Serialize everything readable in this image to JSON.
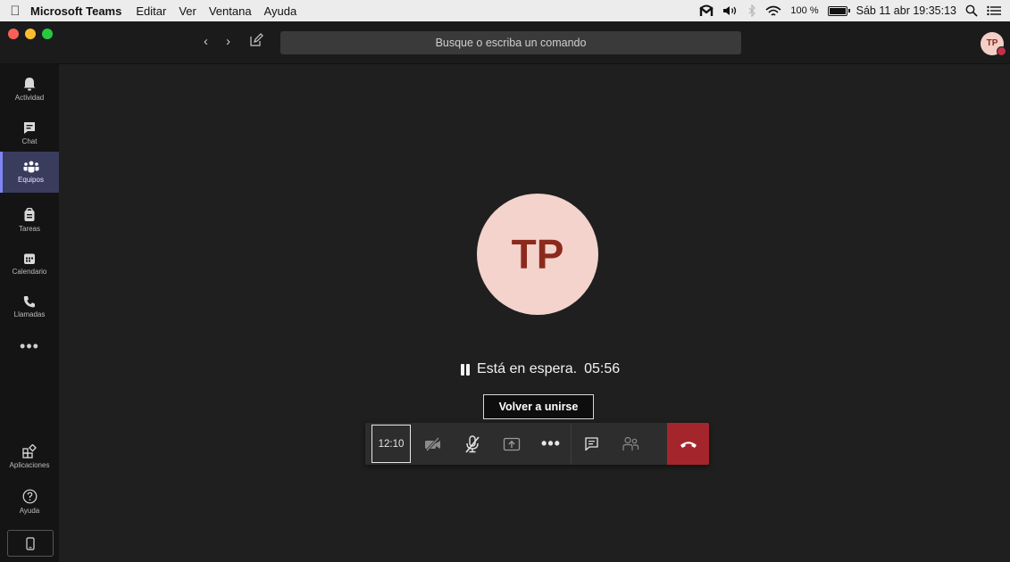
{
  "menubar": {
    "apple_icon": "apple-logo-icon",
    "app_name": "Microsoft Teams",
    "menus": [
      "Editar",
      "Ver",
      "Ventana",
      "Ayuda"
    ],
    "battery_percent": "100 %",
    "battery_level": 1.0,
    "datetime": "Sáb 11 abr 19:35:13"
  },
  "titlebar": {
    "search_placeholder": "Busque o escriba un comando",
    "user_initials": "TP"
  },
  "rail": {
    "items": [
      {
        "label": "Actividad",
        "icon": "bell-icon"
      },
      {
        "label": "Chat",
        "icon": "chat-icon"
      },
      {
        "label": "Equipos",
        "icon": "teams-icon",
        "active": true
      },
      {
        "label": "Tareas",
        "icon": "tasks-icon"
      },
      {
        "label": "Calendario",
        "icon": "calendar-icon"
      },
      {
        "label": "Llamadas",
        "icon": "phone-icon"
      }
    ],
    "more_label": "•••",
    "bottom_items": [
      {
        "label": "Aplicaciones",
        "icon": "apps-icon"
      },
      {
        "label": "Ayuda",
        "icon": "help-icon"
      }
    ]
  },
  "call": {
    "avatar_initials": "TP",
    "hold_text": "Está en espera.",
    "hold_timer": "05:56",
    "tooltip": "Volver a unirse",
    "controls": {
      "duration": "12:10",
      "more_label": "•••"
    }
  },
  "colors": {
    "accent": "#7f85f5",
    "hangup": "#a4262c",
    "avatar_bg": "#f4d3cc",
    "avatar_text": "#8b2a1d"
  }
}
